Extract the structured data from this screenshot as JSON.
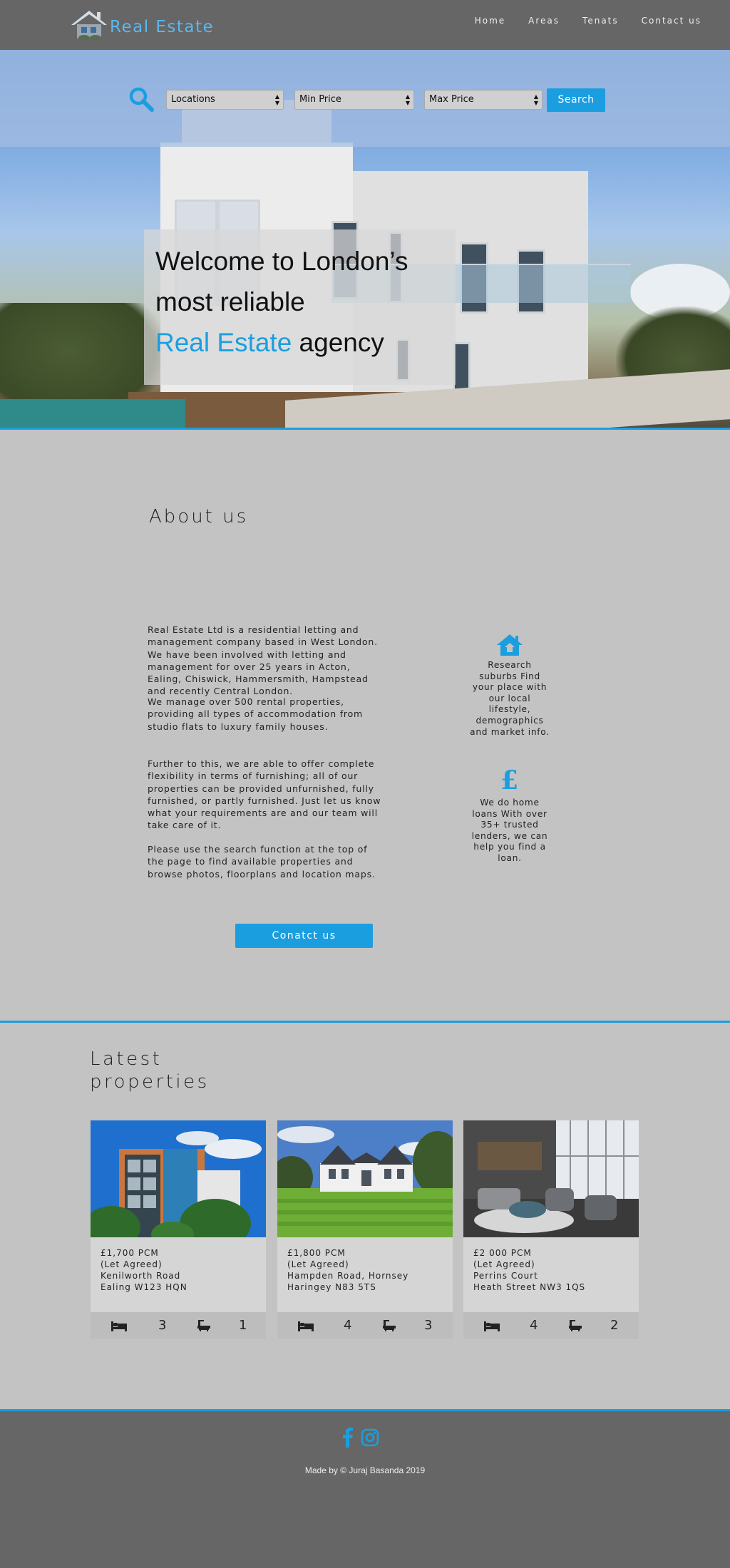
{
  "brand": {
    "name": "Real Estate"
  },
  "nav": {
    "items": [
      "Home",
      "Areas",
      "Tenats",
      "Contact us"
    ]
  },
  "search": {
    "locations": "Locations",
    "min_price": "Min Price",
    "max_price": "Max Price",
    "button": "Search"
  },
  "hero": {
    "line1": "Welcome to London’s",
    "line2": "most reliable",
    "accent": "Real Estate",
    "line3_rest": " agency"
  },
  "about": {
    "title": "About us",
    "paragraph1": "Real Estate Ltd is a residential letting and management company based in West London. We have been involved with letting and management for over 25 years in Acton, Ealing, Chiswick, Hammersmith, Hampstead and recently Central London.",
    "paragraph2": "We manage over 500 rental properties, providing all types of accommodation from studio flats to luxury family houses.",
    "paragraph3": "Further to this, we are able to offer complete flexibility in terms of furnishing; all of our properties can be provided unfurnished, fully furnished, or partly furnished. Just let us know what your requirements are and our team will take care of it.",
    "paragraph4": "Please use the search function at the top of the page to find available properties and browse photos, floorplans and location maps.",
    "features": [
      {
        "icon": "house-icon",
        "text": "Research suburbs Find your place with our local lifestyle, demographics and market info."
      },
      {
        "icon": "pound-icon",
        "symbol": "£",
        "text": "We do home loans With over 35+ trusted lenders, we can help you find a loan."
      }
    ],
    "contact_button": "Conatct us"
  },
  "latest": {
    "title_line1": "Latest",
    "title_line2": "properties",
    "cards": [
      {
        "price": "£1,700 PCM",
        "status": "(Let Agreed)",
        "address1": "Kenilworth Road",
        "address2": "Ealing W123 HQN",
        "beds": "3",
        "baths": "1"
      },
      {
        "price": "£1,800 PCM",
        "status": "(Let Agreed)",
        "address1": "Hampden Road, Hornsey",
        "address2": "Haringey N83 5TS",
        "beds": "4",
        "baths": "3"
      },
      {
        "price": "£2 000 PCM",
        "status": "(Let Agreed)",
        "address1": "Perrins Court",
        "address2": "Heath Street NW3 1QS",
        "beds": "4",
        "baths": "2"
      }
    ]
  },
  "footer": {
    "credit": "Made by © Juraj Basanda 2019",
    "social": [
      "facebook-icon",
      "instagram-icon"
    ]
  },
  "colors": {
    "accent": "#1b9ee0",
    "nav_bg": "#666666",
    "page_bg": "#c3c3c3"
  }
}
